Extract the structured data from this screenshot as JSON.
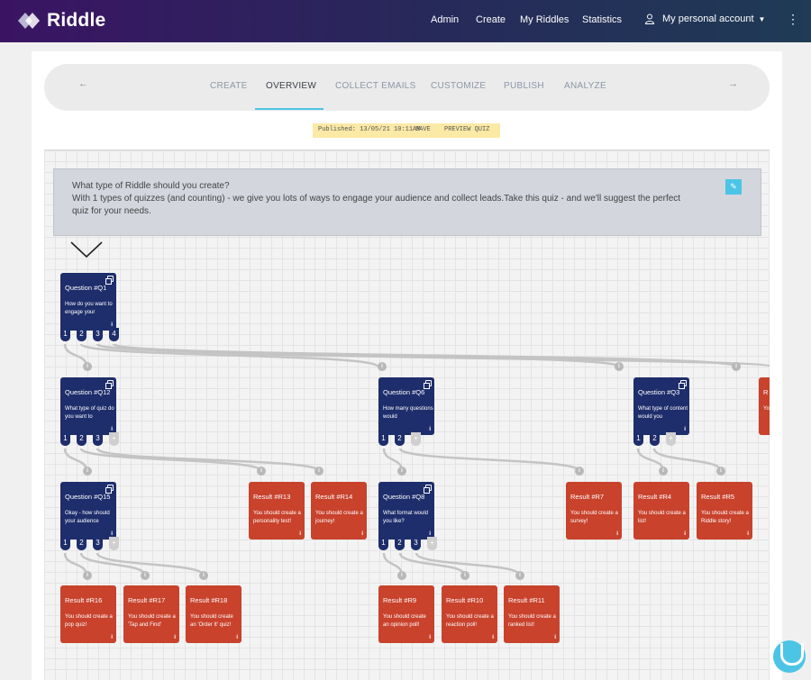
{
  "brand": {
    "name": "Riddle"
  },
  "nav": {
    "admin": "Admin",
    "create": "Create",
    "my_riddles": "My Riddles",
    "statistics": "Statistics",
    "account": "My personal account"
  },
  "steps": {
    "prev": "←",
    "next": "→",
    "items": [
      "CREATE",
      "OVERVIEW",
      "COLLECT EMAILS",
      "CUSTOMIZE",
      "PUBLISH",
      "ANALYZE"
    ],
    "active": "OVERVIEW"
  },
  "publish_bar": {
    "status": "Published: 13/05/21 10:11AM",
    "save": "SAVE",
    "preview": "PREVIEW QUIZ"
  },
  "intro": {
    "title": "What type of Riddle should you create?",
    "text": "With 1 types of quizzes (and counting) - we give you lots of ways to engage your audience and collect leads.Take this quiz - and we'll suggest the perfect quiz for your needs."
  },
  "nodes": {
    "q1": {
      "title": "Question #Q1",
      "text": "How do you want to engage your"
    },
    "q12": {
      "title": "Question #Q12",
      "text": "What type of quiz do you want to"
    },
    "q6": {
      "title": "Question #Q6",
      "text": "How many questions would"
    },
    "q3": {
      "title": "Question #Q3",
      "text": "What type of content would you"
    },
    "q15": {
      "title": "Question #Q15",
      "text": "Okay - how should your audience"
    },
    "q8": {
      "title": "Question #Q8",
      "text": "What format would you like?"
    },
    "r13": {
      "title": "Result #R13",
      "text": "You should create a personality test!"
    },
    "r14": {
      "title": "Result #R14",
      "text": "You should create a journey!"
    },
    "r7": {
      "title": "Result #R7",
      "text": "You should create a survey!"
    },
    "r4": {
      "title": "Result #R4",
      "text": "You should create a list!"
    },
    "r5": {
      "title": "Result #R5",
      "text": "You should create a Riddle story!"
    },
    "r16": {
      "title": "Result #R16",
      "text": "You should create a pop quiz!"
    },
    "r17": {
      "title": "Result #R17",
      "text": "You should create a 'Tap and Find'"
    },
    "r18": {
      "title": "Result #R18",
      "text": "You should create an 'Order It' quiz!"
    },
    "r9": {
      "title": "Result #R9",
      "text": "You should create an opinion poll!"
    },
    "r10": {
      "title": "Result #R10",
      "text": "You should create a reaction poll!"
    },
    "r11": {
      "title": "Result #R11",
      "text": "You should create a ranked list!"
    },
    "partial": {
      "title": "R",
      "text": "Yo"
    }
  },
  "info_glyph": "i",
  "tabs": {
    "n1": "1",
    "n2": "2",
    "n3": "3",
    "n4": "4",
    "plus": "+"
  },
  "colors": {
    "question": "#1e2d6b",
    "result": "#c8422c",
    "accent": "#4cc4e6"
  }
}
